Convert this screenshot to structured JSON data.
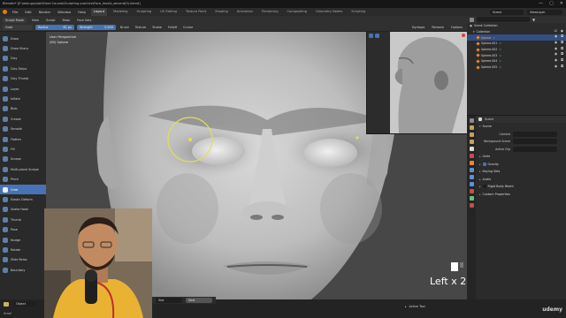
{
  "window": {
    "title": "Blender* [E:\\ashugrp\\dpf\\Hard Course\\Sculpting practice\\Face_levels_second(5).blend]",
    "controls": [
      "—",
      "▢",
      "✕"
    ]
  },
  "menubar": {
    "menus": [
      "File",
      "Edit",
      "Render",
      "Window",
      "Help"
    ],
    "tabs": [
      "Layout",
      "Modeling",
      "Sculpting",
      "UV Editing",
      "Texture Paint",
      "Shading",
      "Animation",
      "Rendering",
      "Compositing",
      "Geometry Nodes",
      "Scripting"
    ],
    "active_tab": "Layout",
    "scene_label": "Scene",
    "view_layer_label": "ViewLayer"
  },
  "tool_header": {
    "mode": "Sculpt Mode",
    "menus": [
      "View",
      "Sculpt",
      "Mask",
      "Face Sets"
    ],
    "brush": "Grab",
    "radius_label": "Radius",
    "radius_value": "61 px",
    "strength_label": "Strength",
    "strength_value": "0.400",
    "dropdowns": [
      "Brush",
      "Texture",
      "Stroke",
      "Falloff",
      "Cursor"
    ],
    "right_items": [
      "Dyntopo",
      "Remesh",
      "Options"
    ]
  },
  "toolbar": {
    "tools": [
      "Draw",
      "Draw Sharp",
      "Clay",
      "Clay Strips",
      "Clay Thumb",
      "Layer",
      "Inflate",
      "Blob",
      "Crease",
      "Smooth",
      "Flatten",
      "Fill",
      "Scrape",
      "Multi-plane Scrape",
      "Pinch",
      "Grab",
      "Elastic Deform",
      "Snake Hook",
      "Thumb",
      "Pose",
      "Nudge",
      "Rotate",
      "Slide Relax",
      "Boundary"
    ],
    "active_tool": "Grab"
  },
  "viewport": {
    "perspective_label": "User Perspective",
    "object_label": "(65) Sphere"
  },
  "outliner": {
    "root": "Scene Collection",
    "collection": "Collection",
    "items": [
      "Sphere",
      "Sphere.001",
      "Sphere.002",
      "Sphere.003",
      "Sphere.004",
      "Sphere.005"
    ]
  },
  "properties": {
    "title": "Scene",
    "sections": {
      "scene": "Scene",
      "camera_label": "Camera",
      "background_label": "Background Scene",
      "active_clip_label": "Active Clip",
      "units": "Units",
      "gravity": "Gravity",
      "keying_sets": "Keying Sets",
      "audio": "Audio",
      "rigid_body": "Rigid Body World",
      "custom_props": "Custom Properties"
    }
  },
  "statusbar": {
    "scroll_label": "Scroll",
    "rotate_view": "Rotate View",
    "context_menu": "Sculpt Context Menu",
    "object_menu": "Object",
    "view_dropdown": "Slot",
    "new_button": "New",
    "active_tool": "Active Tool",
    "watermark": "udemy"
  },
  "overlay": {
    "keystroke_text": "Left x 2"
  },
  "colors": {
    "accent_blue": "#4772b3",
    "active_orange": "#e48a2b",
    "bg_dark": "#1d1d1d",
    "panel": "#2b2b2b",
    "brush_circle": "#e3dd5a"
  }
}
